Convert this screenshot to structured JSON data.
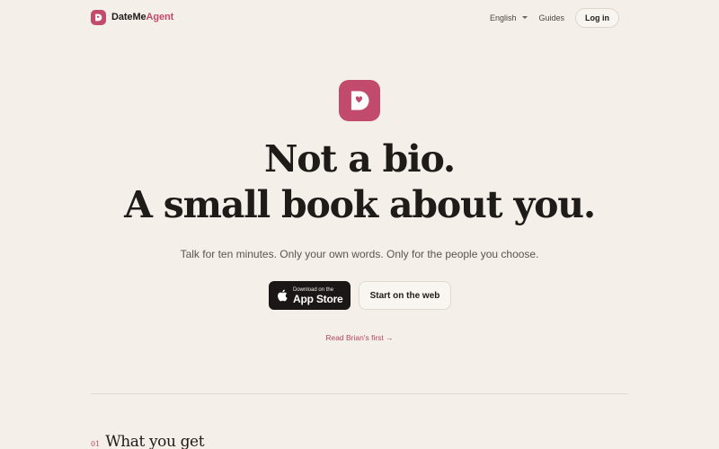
{
  "header": {
    "brand_main": "DateMe",
    "brand_accent": "Agent",
    "language": "English",
    "guides": "Guides",
    "login": "Log in"
  },
  "hero": {
    "headline_line1": "Not a bio.",
    "headline_line2": "A small book about you.",
    "subhead": "Talk for ten minutes. Only your own words. Only for the people you choose.",
    "appstore_small": "Download on the",
    "appstore_big": "App Store",
    "web_cta": "Start on the web",
    "read_link": "Read Brian's first →"
  },
  "section": {
    "number": "01",
    "title": "What you get"
  },
  "colors": {
    "background": "#f4efe9",
    "brand": "#c24a6c",
    "text": "#1f1b19",
    "muted": "#5c5450"
  },
  "icons": {
    "brand": "dateme-logo-icon",
    "apple": "apple-icon",
    "language": "chevron-down-icon"
  }
}
